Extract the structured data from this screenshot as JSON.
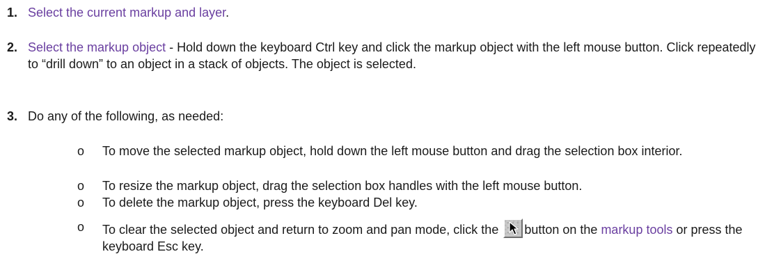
{
  "steps": [
    {
      "number": "1.",
      "link_text": "Select the current markup and layer",
      "after_text": "."
    },
    {
      "number": "2.",
      "link_text": "Select the markup object",
      "after_text": " - Hold down the keyboard Ctrl key and click the markup object with the left mouse button. Click repeatedly to “drill down” to an object in a stack of objects. The object is selected."
    },
    {
      "number": "3.",
      "text": "Do any of the following, as needed:"
    }
  ],
  "sub_items": [
    {
      "bullet": "o",
      "text": "To move the selected markup object, hold down the left mouse button and drag the selection box interior."
    },
    {
      "bullet": "o",
      "text": "To resize the markup object, drag the selection box handles with the left mouse button."
    },
    {
      "bullet": "o",
      "text": "To delete the markup object, press the keyboard Del key."
    },
    {
      "bullet": "o",
      "before_text": "To clear the selected object and return to zoom and pan mode, click the ",
      "icon": "select-arrow-icon",
      "after_icon_text": "button on the ",
      "link_text": "markup tools",
      "after_link_text": " or press the keyboard Esc key."
    }
  ]
}
